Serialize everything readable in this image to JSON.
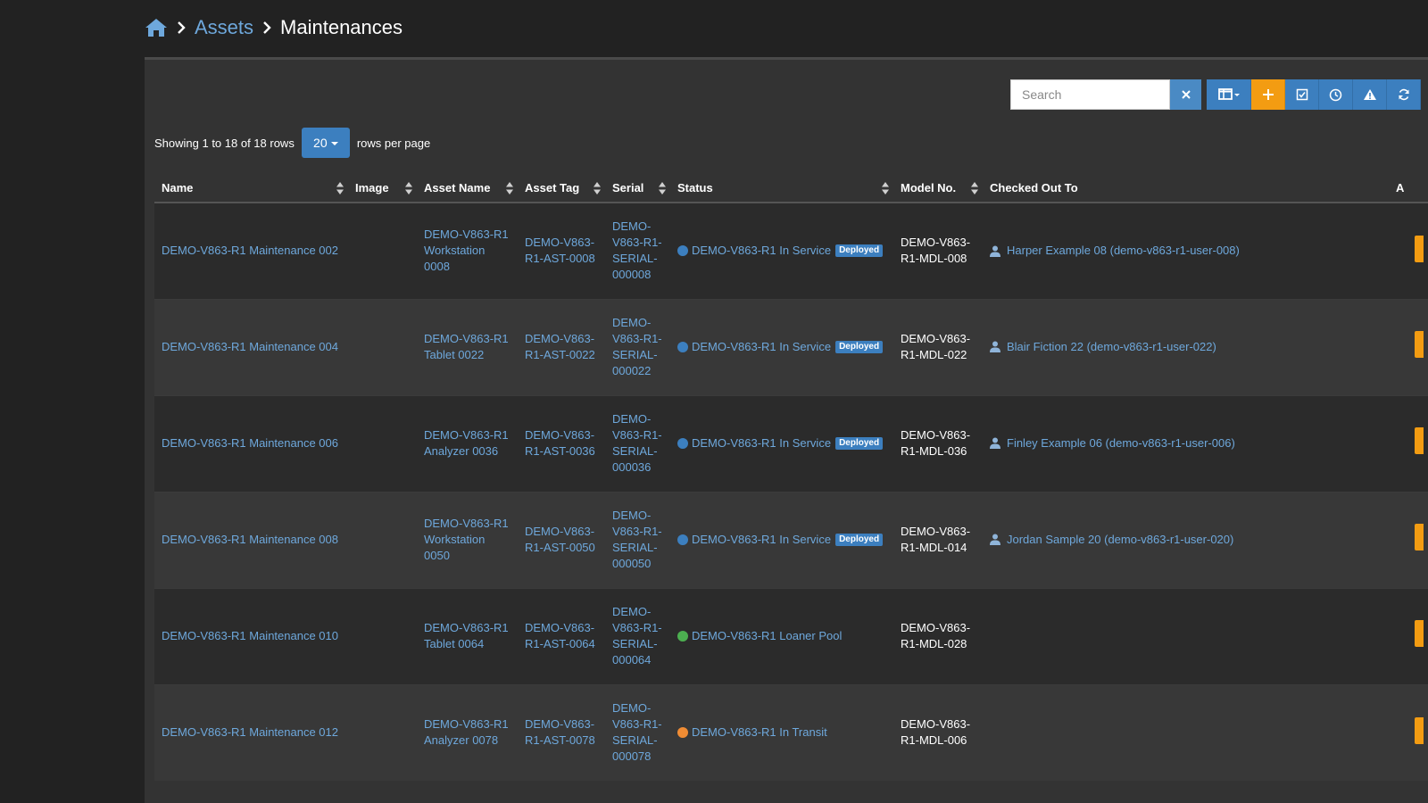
{
  "breadcrumb": {
    "home_icon": "home-icon",
    "items": [
      "Assets",
      "Maintenances"
    ]
  },
  "toolbar": {
    "search_placeholder": "Search",
    "search_value": "",
    "buttons": [
      {
        "name": "clear-search",
        "icon": "close-icon"
      },
      {
        "name": "columns",
        "icon": "columns-icon"
      },
      {
        "name": "add",
        "icon": "plus-icon"
      },
      {
        "name": "select",
        "icon": "checkbox-icon"
      },
      {
        "name": "history",
        "icon": "clock-icon"
      },
      {
        "name": "alerts",
        "icon": "warning-icon"
      },
      {
        "name": "refresh",
        "icon": "refresh-icon"
      }
    ],
    "colors": {
      "blue": "#3c7fbf",
      "orange": "#f39c12"
    }
  },
  "pagination": {
    "info": "Showing 1 to 18 of 18 rows",
    "page_size": "20",
    "suffix": "rows per page"
  },
  "table": {
    "columns": [
      "Name",
      "Image",
      "Asset Name",
      "Asset Tag",
      "Serial",
      "Status",
      "Model No.",
      "Checked Out To",
      "A"
    ],
    "rows": [
      {
        "name": "DEMO-V863-R1 Maintenance 002",
        "asset_name": "DEMO-V863-R1 Workstation 0008",
        "asset_tag": "DEMO-V863-R1-AST-0008",
        "serial": "DEMO-V863-R1-SERIAL-000008",
        "status": "DEMO-V863-R1 In Service",
        "status_color": "#3c7fbf",
        "badge": "Deployed",
        "model": "DEMO-V863-R1-MDL-008",
        "checked_out_to": "Harper Example 08 (demo-v863-r1-user-008)"
      },
      {
        "name": "DEMO-V863-R1 Maintenance 004",
        "asset_name": "DEMO-V863-R1 Tablet 0022",
        "asset_tag": "DEMO-V863-R1-AST-0022",
        "serial": "DEMO-V863-R1-SERIAL-000022",
        "status": "DEMO-V863-R1 In Service",
        "status_color": "#3c7fbf",
        "badge": "Deployed",
        "model": "DEMO-V863-R1-MDL-022",
        "checked_out_to": "Blair Fiction 22 (demo-v863-r1-user-022)"
      },
      {
        "name": "DEMO-V863-R1 Maintenance 006",
        "asset_name": "DEMO-V863-R1 Analyzer 0036",
        "asset_tag": "DEMO-V863-R1-AST-0036",
        "serial": "DEMO-V863-R1-SERIAL-000036",
        "status": "DEMO-V863-R1 In Service",
        "status_color": "#3c7fbf",
        "badge": "Deployed",
        "model": "DEMO-V863-R1-MDL-036",
        "checked_out_to": "Finley Example 06 (demo-v863-r1-user-006)"
      },
      {
        "name": "DEMO-V863-R1 Maintenance 008",
        "asset_name": "DEMO-V863-R1 Workstation 0050",
        "asset_tag": "DEMO-V863-R1-AST-0050",
        "serial": "DEMO-V863-R1-SERIAL-000050",
        "status": "DEMO-V863-R1 In Service",
        "status_color": "#3c7fbf",
        "badge": "Deployed",
        "model": "DEMO-V863-R1-MDL-014",
        "checked_out_to": "Jordan Sample 20 (demo-v863-r1-user-020)"
      },
      {
        "name": "DEMO-V863-R1 Maintenance 010",
        "asset_name": "DEMO-V863-R1 Tablet 0064",
        "asset_tag": "DEMO-V863-R1-AST-0064",
        "serial": "DEMO-V863-R1-SERIAL-000064",
        "status": "DEMO-V863-R1 Loaner Pool",
        "status_color": "#4caf50",
        "badge": "",
        "model": "DEMO-V863-R1-MDL-028",
        "checked_out_to": ""
      },
      {
        "name": "DEMO-V863-R1 Maintenance 012",
        "asset_name": "DEMO-V863-R1 Analyzer 0078",
        "asset_tag": "DEMO-V863-R1-AST-0078",
        "serial": "DEMO-V863-R1-SERIAL-000078",
        "status": "DEMO-V863-R1 In Transit",
        "status_color": "#f08c34",
        "badge": "",
        "model": "DEMO-V863-R1-MDL-006",
        "checked_out_to": ""
      }
    ]
  }
}
